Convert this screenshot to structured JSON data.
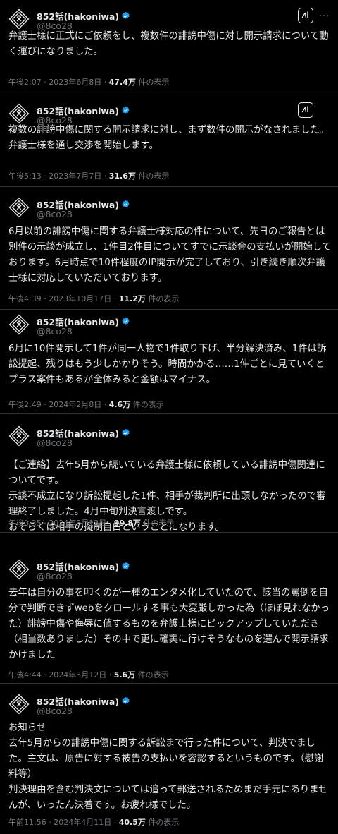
{
  "author": {
    "name": "852話(hakoniwa)",
    "handle": "@8co28"
  },
  "views_suffix": "件の表示",
  "dot": "·",
  "tweets": [
    {
      "body": "弁護士様に正式にご依頼をし、複数件の誹謗中傷に対し開示請求について動く運びになりました。",
      "time": "午後2:07",
      "date": "2023年6月8日",
      "views": "47.4万"
    },
    {
      "body": "複数の誹謗中傷に関する開示請求に対し、まず数件の開示がなされました。弁護士様を通し交渉を開始します。",
      "time": "午後5:13",
      "date": "2023年7月7日",
      "views": "31.6万"
    },
    {
      "body": "6月以前の誹謗中傷に関する弁護士様対応の件について、先日のご報告とは別件の示談が成立し、1件目2件目についてすでに示談金の支払いが開始しております。6月時点で10件程度のIP開示が完了しており、引き続き順次弁護士様に対応していただいております。",
      "time": "午後4:39",
      "date": "2023年10月17日",
      "views": "11.2万"
    },
    {
      "body": "6月に10件開示して1件が同一人物で1件取り下げ、半分解決済み、1件は訴訟提起、残りはもう少しかかりそう。時間かかる……1件ごとに見ていくとプラス案件もあるが全体みると金額はマイナス。",
      "time": "午後2:49",
      "date": "2024年2月8日",
      "views": "4.6万"
    },
    {
      "body": "【ご連絡】去年5月から続いている弁護士様に依頼している誹謗中傷関連についてです。\n示談不成立になり訴訟提起した1件、相手が裁判所に出頭しなかったので審理終了しました。4月中旬判決言渡しです。\nおそらくは相手の擬制自白ということになります。",
      "time": "午後0:35",
      "date": "2024年3月12日",
      "views": "99.8万"
    },
    {
      "body": "去年は自分の事を叩くのが一種のエンタメ化していたので、該当の罵倒を自分で判断できずwebをクロールする事も大変厳しかった為（ほぼ見れなかった）誹謗中傷や侮辱に値するものを弁護士様にピックアップしていただき（相当数ありました）その中で更に確実に行けそうなものを選んで開示請求かけました",
      "time": "午後4:44",
      "date": "2024年3月12日",
      "views": "5.6万"
    },
    {
      "body": "お知らせ\n去年5月からの誹謗中傷に関する訴訟まで行った件について、判決でました。主文は、原告に対する被告の支払いを容認するというものです。（慰謝料等）\n判決理由を含む判決文については追って郵送されるためまだ手元にありませんが、いったん決着です。お疲れ様でした。",
      "time": "午前11:56",
      "date": "2024年4月11日",
      "views": "40.5万"
    }
  ]
}
